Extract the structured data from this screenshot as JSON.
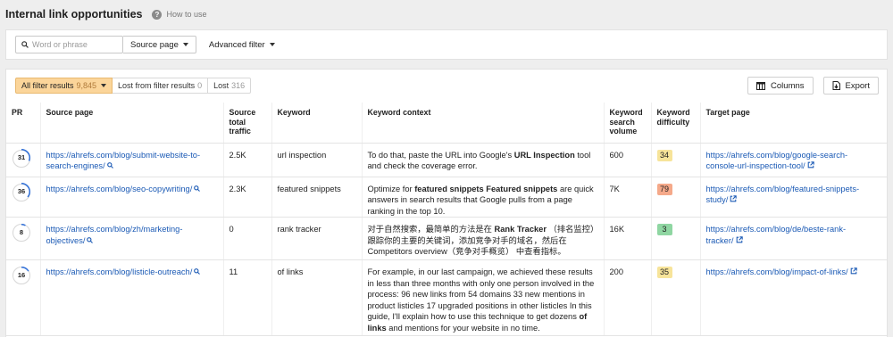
{
  "header": {
    "title": "Internal link opportunities",
    "help_label": "How to use"
  },
  "filters": {
    "search_placeholder": "Word or phrase",
    "scope_label": "Source page",
    "advanced_label": "Advanced filter"
  },
  "tabs": [
    {
      "label": "All filter results",
      "count": "9,845"
    },
    {
      "label": "Lost from filter results",
      "count": "0"
    },
    {
      "label": "Lost",
      "count": "316"
    }
  ],
  "toolbar": {
    "columns_label": "Columns",
    "export_label": "Export"
  },
  "columns": {
    "pr": "PR",
    "source_page": "Source page",
    "source_traffic_1": "Source",
    "source_traffic_2": "total",
    "source_traffic_3": "traffic",
    "keyword": "Keyword",
    "keyword_context": "Keyword context",
    "volume_1": "Keyword",
    "volume_2": "search",
    "volume_3": "volume",
    "kd_1": "Keyword",
    "kd_2": "difficulty",
    "target_page": "Target page"
  },
  "rows": [
    {
      "pr": "31",
      "pr_fill": 0.31,
      "source_1": "https://ahrefs.com/blog/submit-website-to-",
      "source_2": "search-engines/",
      "traffic": "2.5K",
      "keyword": "url inspection",
      "ctx": [
        {
          "t": "To do that, paste the URL into Google's ",
          "b": false
        },
        {
          "t": "URL Inspection",
          "b": true
        },
        {
          "t": " tool and check the coverage error.",
          "b": false
        }
      ],
      "volume": "600",
      "kd": "34",
      "kd_color": "#f7e49a",
      "target_1": "https://ahrefs.com/blog/google-search-",
      "target_2": "console-url-inspection-tool/"
    },
    {
      "pr": "36",
      "pr_fill": 0.36,
      "source_1": "https://ahrefs.com/blog/seo-copywriting/",
      "source_2": "",
      "traffic": "2.3K",
      "keyword": "featured snippets",
      "ctx": [
        {
          "t": "Optimize for ",
          "b": false
        },
        {
          "t": "featured snippets Featured snippets",
          "b": true
        },
        {
          "t": " are quick answers in search results that Google pulls from a page ranking in the top 10.",
          "b": false
        }
      ],
      "volume": "7K",
      "kd": "79",
      "kd_color": "#f5a98a",
      "target_1": "https://ahrefs.com/blog/featured-snippets-",
      "target_2": "study/"
    },
    {
      "pr": "8",
      "pr_fill": 0.08,
      "source_1": "https://ahrefs.com/blog/zh/marketing-",
      "source_2": "objectives/",
      "traffic": "0",
      "keyword": "rank tracker",
      "ctx": [
        {
          "t": "对于自然搜索，最简单的方法是在 ",
          "b": false
        },
        {
          "t": "Rank Tracker",
          "b": true
        },
        {
          "t": " （排名监控）跟踪你的主要的关键词，添加竞争对手的域名，然后在 Competitors overview（竞争对手概览） 中查看指标。",
          "b": false
        }
      ],
      "volume": "16K",
      "kd": "3",
      "kd_color": "#8fd6a2",
      "target_1": "https://ahrefs.com/blog/de/beste-rank-",
      "target_2": "tracker/"
    },
    {
      "pr": "16",
      "pr_fill": 0.16,
      "source_1": "https://ahrefs.com/blog/listicle-outreach/",
      "source_2": "",
      "traffic": "11",
      "keyword": "of links",
      "ctx": [
        {
          "t": "For example, in our last campaign, we achieved these results in less than three months with only one person involved in the process: 96 new links from 54 domains 33 new mentions in product listicles 17 upgraded positions in other listicles In this guide, I'll explain how to use this technique to get dozens ",
          "b": false
        },
        {
          "t": "of links",
          "b": true
        },
        {
          "t": " and mentions for your website in no time.",
          "b": false
        }
      ],
      "volume": "200",
      "kd": "35",
      "kd_color": "#f7e49a",
      "target_1": "https://ahrefs.com/blog/impact-of-links/",
      "target_2": ""
    }
  ]
}
